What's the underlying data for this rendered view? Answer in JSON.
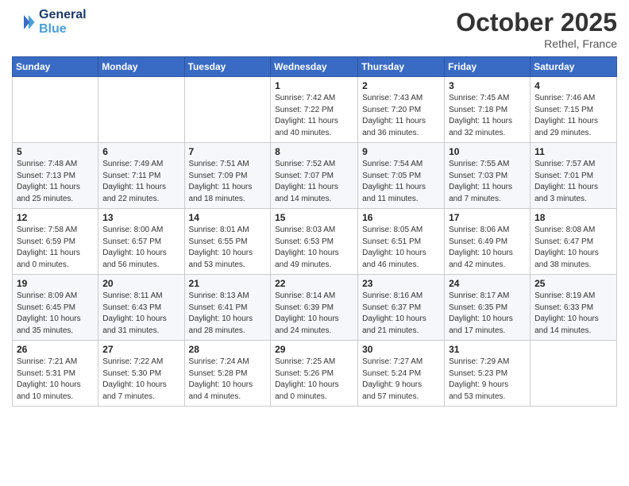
{
  "logo": {
    "line1": "General",
    "line2": "Blue"
  },
  "title": "October 2025",
  "location": "Rethel, France",
  "days_header": [
    "Sunday",
    "Monday",
    "Tuesday",
    "Wednesday",
    "Thursday",
    "Friday",
    "Saturday"
  ],
  "weeks": [
    [
      {
        "day": "",
        "info": ""
      },
      {
        "day": "",
        "info": ""
      },
      {
        "day": "",
        "info": ""
      },
      {
        "day": "1",
        "info": "Sunrise: 7:42 AM\nSunset: 7:22 PM\nDaylight: 11 hours\nand 40 minutes."
      },
      {
        "day": "2",
        "info": "Sunrise: 7:43 AM\nSunset: 7:20 PM\nDaylight: 11 hours\nand 36 minutes."
      },
      {
        "day": "3",
        "info": "Sunrise: 7:45 AM\nSunset: 7:18 PM\nDaylight: 11 hours\nand 32 minutes."
      },
      {
        "day": "4",
        "info": "Sunrise: 7:46 AM\nSunset: 7:15 PM\nDaylight: 11 hours\nand 29 minutes."
      }
    ],
    [
      {
        "day": "5",
        "info": "Sunrise: 7:48 AM\nSunset: 7:13 PM\nDaylight: 11 hours\nand 25 minutes."
      },
      {
        "day": "6",
        "info": "Sunrise: 7:49 AM\nSunset: 7:11 PM\nDaylight: 11 hours\nand 22 minutes."
      },
      {
        "day": "7",
        "info": "Sunrise: 7:51 AM\nSunset: 7:09 PM\nDaylight: 11 hours\nand 18 minutes."
      },
      {
        "day": "8",
        "info": "Sunrise: 7:52 AM\nSunset: 7:07 PM\nDaylight: 11 hours\nand 14 minutes."
      },
      {
        "day": "9",
        "info": "Sunrise: 7:54 AM\nSunset: 7:05 PM\nDaylight: 11 hours\nand 11 minutes."
      },
      {
        "day": "10",
        "info": "Sunrise: 7:55 AM\nSunset: 7:03 PM\nDaylight: 11 hours\nand 7 minutes."
      },
      {
        "day": "11",
        "info": "Sunrise: 7:57 AM\nSunset: 7:01 PM\nDaylight: 11 hours\nand 3 minutes."
      }
    ],
    [
      {
        "day": "12",
        "info": "Sunrise: 7:58 AM\nSunset: 6:59 PM\nDaylight: 11 hours\nand 0 minutes."
      },
      {
        "day": "13",
        "info": "Sunrise: 8:00 AM\nSunset: 6:57 PM\nDaylight: 10 hours\nand 56 minutes."
      },
      {
        "day": "14",
        "info": "Sunrise: 8:01 AM\nSunset: 6:55 PM\nDaylight: 10 hours\nand 53 minutes."
      },
      {
        "day": "15",
        "info": "Sunrise: 8:03 AM\nSunset: 6:53 PM\nDaylight: 10 hours\nand 49 minutes."
      },
      {
        "day": "16",
        "info": "Sunrise: 8:05 AM\nSunset: 6:51 PM\nDaylight: 10 hours\nand 46 minutes."
      },
      {
        "day": "17",
        "info": "Sunrise: 8:06 AM\nSunset: 6:49 PM\nDaylight: 10 hours\nand 42 minutes."
      },
      {
        "day": "18",
        "info": "Sunrise: 8:08 AM\nSunset: 6:47 PM\nDaylight: 10 hours\nand 38 minutes."
      }
    ],
    [
      {
        "day": "19",
        "info": "Sunrise: 8:09 AM\nSunset: 6:45 PM\nDaylight: 10 hours\nand 35 minutes."
      },
      {
        "day": "20",
        "info": "Sunrise: 8:11 AM\nSunset: 6:43 PM\nDaylight: 10 hours\nand 31 minutes."
      },
      {
        "day": "21",
        "info": "Sunrise: 8:13 AM\nSunset: 6:41 PM\nDaylight: 10 hours\nand 28 minutes."
      },
      {
        "day": "22",
        "info": "Sunrise: 8:14 AM\nSunset: 6:39 PM\nDaylight: 10 hours\nand 24 minutes."
      },
      {
        "day": "23",
        "info": "Sunrise: 8:16 AM\nSunset: 6:37 PM\nDaylight: 10 hours\nand 21 minutes."
      },
      {
        "day": "24",
        "info": "Sunrise: 8:17 AM\nSunset: 6:35 PM\nDaylight: 10 hours\nand 17 minutes."
      },
      {
        "day": "25",
        "info": "Sunrise: 8:19 AM\nSunset: 6:33 PM\nDaylight: 10 hours\nand 14 minutes."
      }
    ],
    [
      {
        "day": "26",
        "info": "Sunrise: 7:21 AM\nSunset: 5:31 PM\nDaylight: 10 hours\nand 10 minutes."
      },
      {
        "day": "27",
        "info": "Sunrise: 7:22 AM\nSunset: 5:30 PM\nDaylight: 10 hours\nand 7 minutes."
      },
      {
        "day": "28",
        "info": "Sunrise: 7:24 AM\nSunset: 5:28 PM\nDaylight: 10 hours\nand 4 minutes."
      },
      {
        "day": "29",
        "info": "Sunrise: 7:25 AM\nSunset: 5:26 PM\nDaylight: 10 hours\nand 0 minutes."
      },
      {
        "day": "30",
        "info": "Sunrise: 7:27 AM\nSunset: 5:24 PM\nDaylight: 9 hours\nand 57 minutes."
      },
      {
        "day": "31",
        "info": "Sunrise: 7:29 AM\nSunset: 5:23 PM\nDaylight: 9 hours\nand 53 minutes."
      },
      {
        "day": "",
        "info": ""
      }
    ]
  ]
}
